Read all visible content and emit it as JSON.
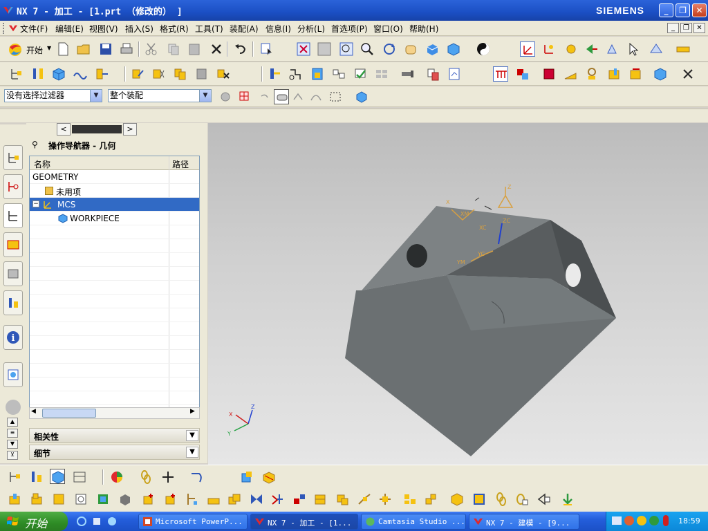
{
  "titlebar": {
    "title": "NX 7 - 加工 - [1.prt （修改的） ]",
    "brand": "SIEMENS",
    "min_icon": "minimize-icon",
    "max_icon": "restore-icon",
    "close_icon": "close-icon"
  },
  "menu": {
    "items": [
      "文件(F)",
      "编辑(E)",
      "视图(V)",
      "插入(S)",
      "格式(R)",
      "工具(T)",
      "装配(A)",
      "信息(I)",
      "分析(L)",
      "首选项(P)",
      "窗口(O)",
      "帮助(H)"
    ]
  },
  "toolbar": {
    "start_label": "开始"
  },
  "filters": {
    "selection_filter": "没有选择过滤器",
    "assembly_scope": "整个装配"
  },
  "navigator": {
    "title": "操作导航器 - 几何",
    "col_name": "名称",
    "col_path": "路径",
    "rows": [
      {
        "label": "GEOMETRY",
        "icon": "none"
      },
      {
        "label": "未用项",
        "icon": "folder-icon"
      },
      {
        "label": "MCS",
        "icon": "mcs-icon"
      },
      {
        "label": "WORKPIECE",
        "icon": "workpiece-icon"
      }
    ],
    "section_related": "相关性",
    "section_detail": "细节"
  },
  "viewport": {
    "axis_labels": {
      "x": "X",
      "y": "Y",
      "z": "Z"
    },
    "wcs_labels": {
      "zc": "ZC",
      "xc": "XC",
      "yc": "YC",
      "xm": "XM",
      "ym": "YM",
      "z": "Z",
      "x": "X"
    }
  },
  "taskbar": {
    "start": "开始",
    "tasks": [
      {
        "label": "Microsoft PowerP...",
        "icon": "powerpoint-icon"
      },
      {
        "label": "NX 7 - 加工 - [1...",
        "icon": "nx-icon"
      },
      {
        "label": "Camtasia Studio ...",
        "icon": "camtasia-icon"
      },
      {
        "label": "NX 7 - 建模 - [9...",
        "icon": "nx-icon"
      }
    ],
    "clock": "18:59"
  },
  "colors": {
    "title_blue": "#1b4fc4",
    "selection_blue": "#316ac5",
    "part_gray": "#6b7072",
    "taskbar_blue": "#245edb"
  }
}
